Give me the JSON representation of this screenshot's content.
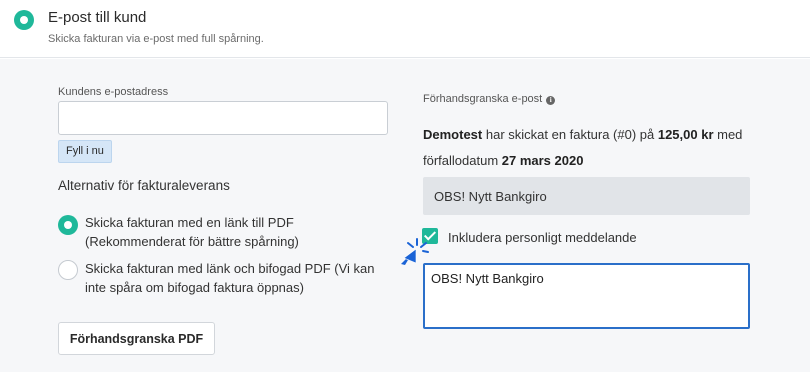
{
  "header": {
    "title": "E-post till kund",
    "subtitle": "Skicka fakturan via e-post med full spårning."
  },
  "form": {
    "email_label": "Kundens e-postadress",
    "email_value": "",
    "fill_button": "Fyll i nu",
    "delivery_heading": "Alternativ för fakturaleverans",
    "options": [
      {
        "label": "Skicka fakturan med en länk till PDF (Rekommenderat för bättre spårning)",
        "selected": true
      },
      {
        "label": "Skicka fakturan med länk och bifogad PDF (Vi kan inte spåra om bifogad faktura öppnas)",
        "selected": false
      }
    ],
    "preview_pdf_button": "Förhandsgranska PDF"
  },
  "preview": {
    "label": "Förhandsgranska e-post",
    "sender": "Demotest",
    "text_1": " har skickat en faktura (#0) på ",
    "amount": "125,00 kr",
    "text_2": " med förfallodatum ",
    "due_date": "27 mars 2020",
    "message_display": "OBS! Nytt Bankgiro",
    "include_message_label": "Inkludera personligt meddelande",
    "include_message_checked": true,
    "message_input_value": "OBS! Nytt Bankgiro"
  },
  "colors": {
    "accent_green": "#1fb89a",
    "focus_blue": "#2a6fc9",
    "fill_button_bg": "#d5e6f7",
    "panel_bg": "#f6f7f9"
  }
}
